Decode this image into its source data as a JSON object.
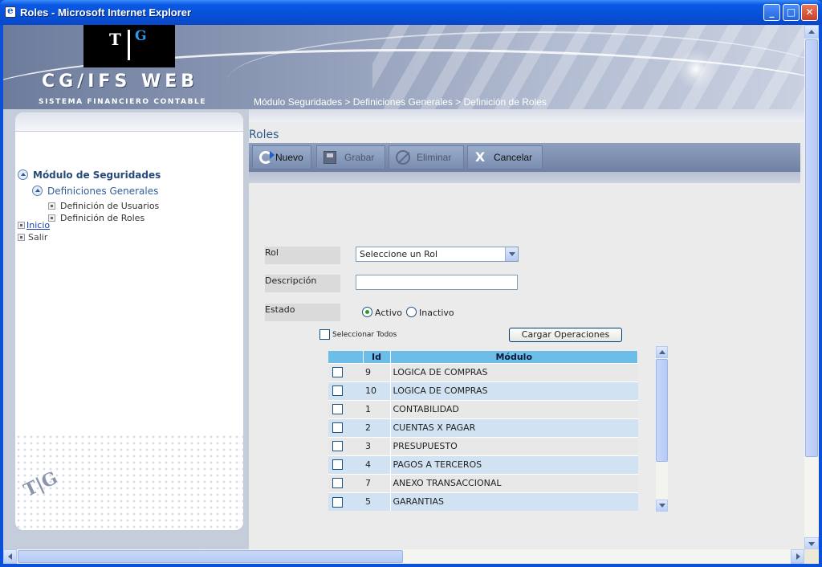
{
  "window": {
    "title": "Roles - Microsoft Internet Explorer"
  },
  "header": {
    "logo_left": "T",
    "logo_right": "G",
    "brand": "CG/IFS  WEB",
    "brand_subtitle": "SISTEMA FINANCIERO CONTABLE",
    "breadcrumb": "Módulo Seguridades > Definiciones Generales > Definición de Roles"
  },
  "sidebar": {
    "root": "Módulo de Seguridades",
    "group": "Definiciones Generales",
    "items": [
      "Definición de Usuarios",
      "Definición de Roles"
    ],
    "links": [
      "Inicio",
      "Salir"
    ]
  },
  "page": {
    "title": "Roles"
  },
  "toolbar": {
    "nuevo": "Nuevo",
    "grabar": "Grabar",
    "eliminar": "Eliminar",
    "cancelar": "Cancelar"
  },
  "form": {
    "rol_label": "Rol",
    "rol_value": "Seleccione un Rol",
    "descripcion_label": "Descripción",
    "descripcion_value": "",
    "estado_label": "Estado",
    "estado_options": [
      "Activo",
      "Inactivo"
    ],
    "estado_selected": "Activo",
    "select_all_label": "Seleccionar Todos",
    "cargar_button": "Cargar Operaciones"
  },
  "grid": {
    "columns": [
      "",
      "Id",
      "Módulo"
    ],
    "rows": [
      {
        "id": "9",
        "modulo": "LOGICA DE COMPRAS"
      },
      {
        "id": "10",
        "modulo": "LOGICA DE COMPRAS"
      },
      {
        "id": "1",
        "modulo": "CONTABILIDAD"
      },
      {
        "id": "2",
        "modulo": "CUENTAS X PAGAR"
      },
      {
        "id": "3",
        "modulo": "PRESUPUESTO"
      },
      {
        "id": "4",
        "modulo": "PAGOS A TERCEROS"
      },
      {
        "id": "7",
        "modulo": "ANEXO TRANSACCIONAL"
      },
      {
        "id": "5",
        "modulo": "GARANTIAS"
      }
    ]
  },
  "colors": {
    "titlebar": "#0651d8",
    "toolbar": "#7b8db0",
    "grid_header": "#6cbde8",
    "grid_row_alt": "#d1e3f3",
    "link": "#1a3da8"
  }
}
